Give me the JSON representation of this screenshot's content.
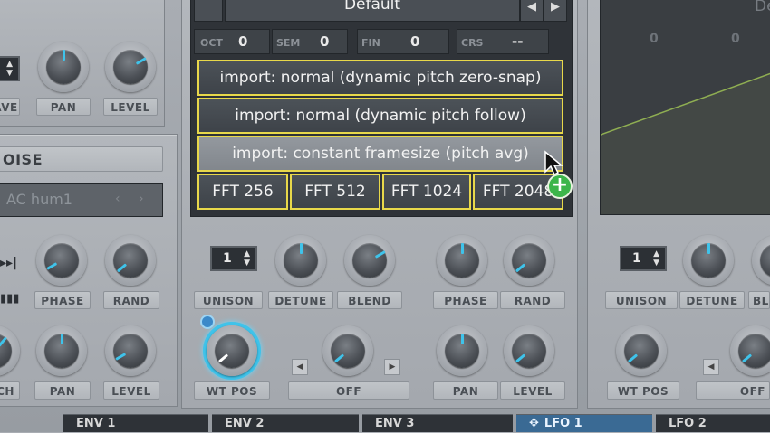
{
  "colors": {
    "accent": "#3fc3ea",
    "menu_border": "#e8d84a",
    "add_badge": "#3cb54a"
  },
  "left_panel": {
    "octave_label": "AVE",
    "pan_label": "PAN",
    "level_label": "LEVEL",
    "noise_title": "OISE",
    "noise_preset": "AC hum1",
    "phase_label": "PHASE",
    "rand_label": "RAND",
    "pitch_label": "CH",
    "pan2_label": "PAN",
    "level2_label": "LEVEL"
  },
  "osc_a": {
    "wavetable_name": "Default",
    "oct_label": "OCT",
    "oct_value": "0",
    "sem_label": "SEM",
    "sem_value": "0",
    "fin_label": "FIN",
    "fin_value": "0",
    "crs_label": "CRS",
    "crs_value": "--",
    "unison_value": "1",
    "unison_label": "UNISON",
    "detune_label": "DETUNE",
    "blend_label": "BLEND",
    "phase_label": "PHASE",
    "rand_label": "RAND",
    "wtpos_label": "WT POS",
    "warp_value": "OFF",
    "pan_label": "PAN",
    "level_label": "LEVEL"
  },
  "import_menu": {
    "items": [
      "import: normal (dynamic pitch zero-snap)",
      "import: normal (dynamic pitch follow)",
      "import: constant framesize (pitch avg)"
    ],
    "fft": [
      "FFT 256",
      "FFT 512",
      "FFT 1024",
      "FFT 2048"
    ]
  },
  "osc_b": {
    "name_partial": "De",
    "zero_a": "0",
    "zero_b": "0",
    "unison_value": "1",
    "unison_label": "UNISON",
    "detune_label": "DETUNE",
    "blend_label": "BL",
    "wtpos_label": "WT POS",
    "warp_value": "OFF"
  },
  "tabs": [
    "ENV 1",
    "ENV 2",
    "ENV 3",
    "LFO 1",
    "LFO 2"
  ]
}
